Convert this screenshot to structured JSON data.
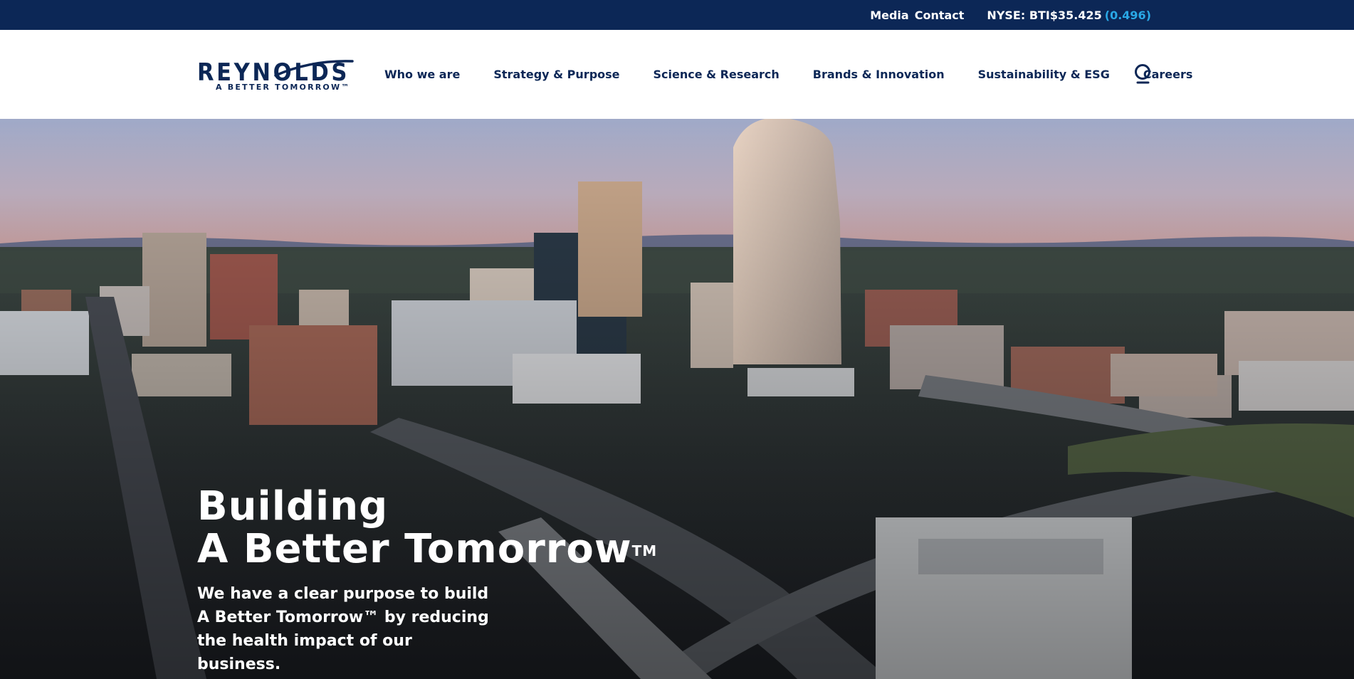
{
  "utility": {
    "links": [
      "Media",
      "Contact"
    ],
    "stock_label": "NYSE: BTI$35.425",
    "stock_change": "(0.496)"
  },
  "brand": {
    "name": "REYNOLDS",
    "tagline": "A BETTER TOMORROW™",
    "colors": {
      "navy": "#0c2756",
      "accent_blue": "#29a8e6"
    }
  },
  "nav": {
    "items": [
      "Who we are",
      "Strategy & Purpose",
      "Science & Research",
      "Brands & Innovation",
      "Sustainability & ESG",
      "Careers"
    ],
    "search_icon": "search-icon"
  },
  "hero": {
    "title_line1": "Building",
    "title_line2": "A Better Tomorrow",
    "title_tm": "TM",
    "subtitle_line1": "We have a clear purpose to build",
    "subtitle_line2": "A Better Tomorrow™ by reducing",
    "subtitle_line3": "the health impact of our business."
  }
}
